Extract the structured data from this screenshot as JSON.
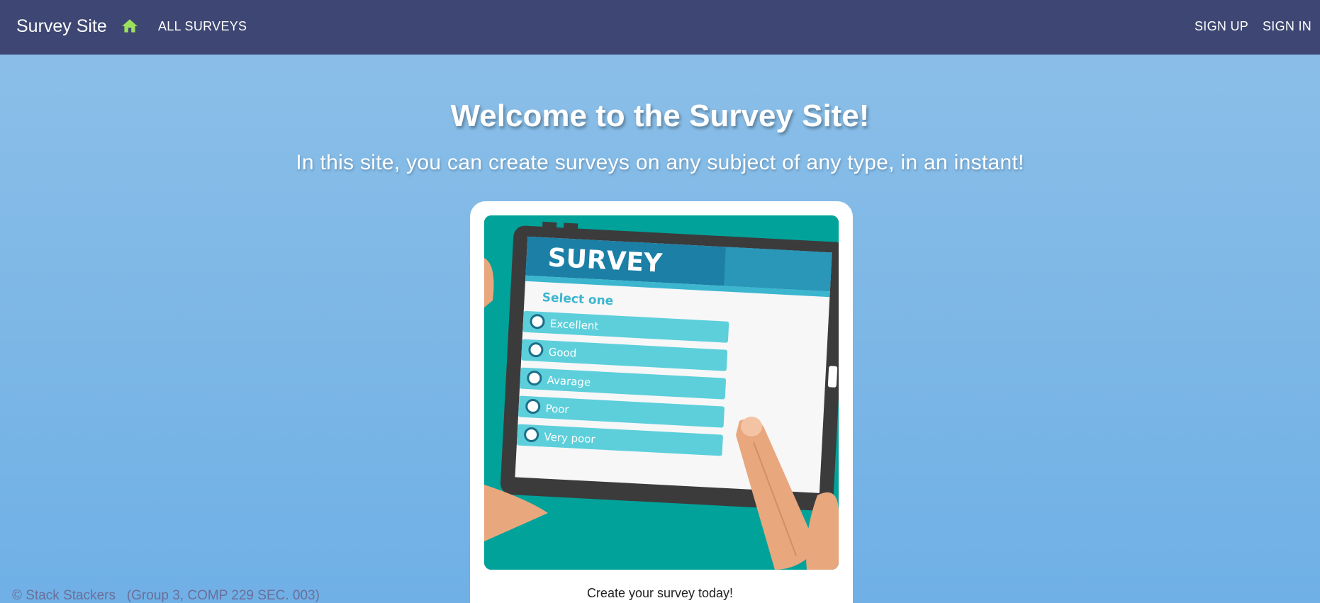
{
  "navbar": {
    "brand": "Survey Site",
    "home_icon": "home-icon",
    "all_surveys": "ALL SURVEYS",
    "sign_up": "SIGN UP",
    "sign_in": "SIGN IN",
    "colors": {
      "background": "#3e4773",
      "home_icon": "#9be05c"
    }
  },
  "hero": {
    "title": "Welcome to the Survey Site!",
    "subtitle": "In this site, you can create surveys on any subject of any type, in an instant!"
  },
  "card": {
    "image": {
      "heading": "SURVEY",
      "prompt": "Select one",
      "options": [
        "Excellent",
        "Good",
        "Avarage",
        "Poor",
        "Very poor"
      ]
    },
    "caption": "Create your survey today!"
  },
  "footer": {
    "text": "© Stack Stackers   (Group 3, COMP 229 SEC. 003)"
  },
  "colors": {
    "page_background": "#7bb6e6",
    "card_background": "#ffffff",
    "image_teal": "#00a29a"
  }
}
